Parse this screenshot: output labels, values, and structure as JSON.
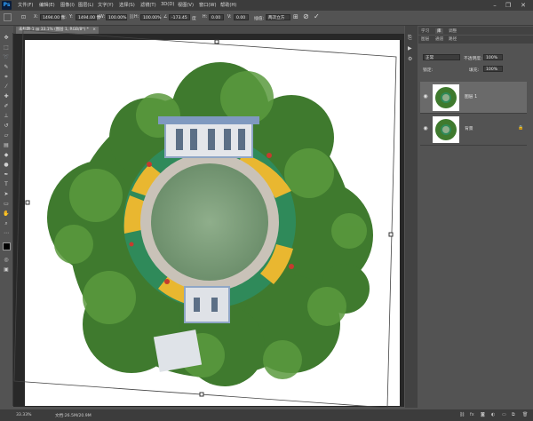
{
  "app": {
    "logo": "Ps"
  },
  "menu": [
    "文件(F)",
    "编辑(E)",
    "图像(I)",
    "图层(L)",
    "文字(Y)",
    "选择(S)",
    "滤镜(T)",
    "3D(D)",
    "视图(V)",
    "窗口(W)",
    "帮助(H)"
  ],
  "options": {
    "x_label": "X:",
    "x_value": "1494.00 像",
    "y_label": "Y:",
    "y_value": "1494.00 像",
    "w_label": "W:",
    "w_value": "100.00%",
    "h_label": "H:",
    "h_value": "100.00%",
    "angle_value": "-173.45",
    "angle_unit": "度",
    "hskew_label": "H:",
    "hskew_value": "0.00",
    "vskew_label": "V:",
    "vskew_value": "0.00",
    "interp_label": "插值:",
    "interp_value": "两次立方"
  },
  "document": {
    "tab_label": "未标题-1 @ 33.1% (图层 1, RGB/8*) *"
  },
  "status": {
    "zoom": "33.33%",
    "doc_info": "文档:26.5M/20.9M"
  },
  "panels": {
    "top_tabs": [
      "学习",
      "库",
      "调整"
    ],
    "layer_tabs": [
      "图层",
      "通道",
      "路径"
    ],
    "blend_mode": "正常",
    "opacity_label": "不透明度:",
    "opacity_value": "100%",
    "lock_label": "锁定:",
    "fill_label": "填充:",
    "fill_value": "100%",
    "layers": [
      {
        "name": "图层 1",
        "selected": true
      },
      {
        "name": "背景",
        "selected": false
      }
    ]
  }
}
